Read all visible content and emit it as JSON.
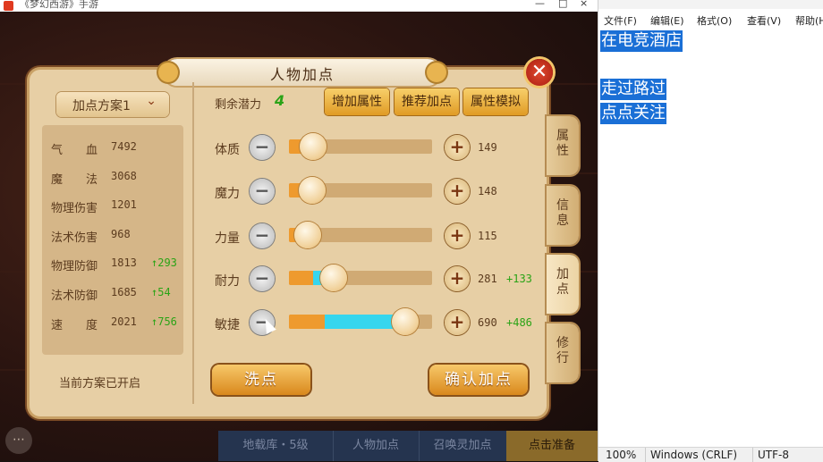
{
  "game_window": {
    "title": "《梦幻西游》手游",
    "controls": [
      "—",
      "□",
      "×"
    ]
  },
  "panel": {
    "title": "人物加点",
    "close_icon": "close-icon",
    "scheme": {
      "label": "加点方案1",
      "chevron": "⌄"
    },
    "stats": [
      {
        "name": "气　　血",
        "value": "7492",
        "bonus": ""
      },
      {
        "name": "魔　　法",
        "value": "3068",
        "bonus": ""
      },
      {
        "name": "物理伤害",
        "value": "1201",
        "bonus": ""
      },
      {
        "name": "法术伤害",
        "value": "968",
        "bonus": ""
      },
      {
        "name": "物理防御",
        "value": "1813",
        "bonus": "↑293"
      },
      {
        "name": "法术防御",
        "value": "1685",
        "bonus": "↑54"
      },
      {
        "name": "速　　度",
        "value": "2021",
        "bonus": "↑756"
      }
    ],
    "footer_note": "当前方案已开启",
    "potential": {
      "label": "剩余潜力",
      "value": "4"
    },
    "top_buttons": [
      "增加属性",
      "推荐加点",
      "属性模拟"
    ],
    "attributes": [
      {
        "name": "体质",
        "minus": "−",
        "plus": "+",
        "value": "149",
        "bonus": "",
        "base_fraction": 0.17,
        "added_fraction": 0
      },
      {
        "name": "魔力",
        "minus": "−",
        "plus": "+",
        "value": "148",
        "bonus": "",
        "base_fraction": 0.16,
        "added_fraction": 0
      },
      {
        "name": "力量",
        "minus": "−",
        "plus": "+",
        "value": "115",
        "bonus": "",
        "base_fraction": 0.13,
        "added_fraction": 0
      },
      {
        "name": "耐力",
        "minus": "−",
        "plus": "+",
        "value": "281",
        "bonus": "+133",
        "base_fraction": 0.17,
        "added_fraction": 0.14
      },
      {
        "name": "敏捷",
        "minus": "−",
        "plus": "+",
        "value": "690",
        "bonus": "+486",
        "base_fraction": 0.25,
        "added_fraction": 0.56
      }
    ],
    "wash_button": "洗点",
    "confirm_button": "确认加点",
    "side_tabs": [
      "属性",
      "信息",
      "加点",
      "修行"
    ],
    "active_tab": "加点"
  },
  "bottom_bar": {
    "items": [
      "地载库・5级",
      "人物加点",
      "召唤灵加点",
      "点击准备"
    ],
    "chat_icon": "chat-icon"
  },
  "notepad": {
    "menu": [
      "文件(F)",
      "编辑(E)",
      "格式(O)",
      "查看(V)",
      "帮助(H)"
    ],
    "lines": [
      "在电竞酒店",
      "",
      "走过路过",
      "点点关注"
    ],
    "status": {
      "zoom": "100%",
      "line_ending": "Windows (CRLF)",
      "encoding": "UTF-8"
    }
  },
  "colors": {
    "panel_bg": "#e7cfa5",
    "potential_green": "#2aa316",
    "bar_base_orange": "#ee9a2e",
    "bar_added_cyan": "#36d6ee",
    "selection_blue": "#1a6fd6"
  }
}
